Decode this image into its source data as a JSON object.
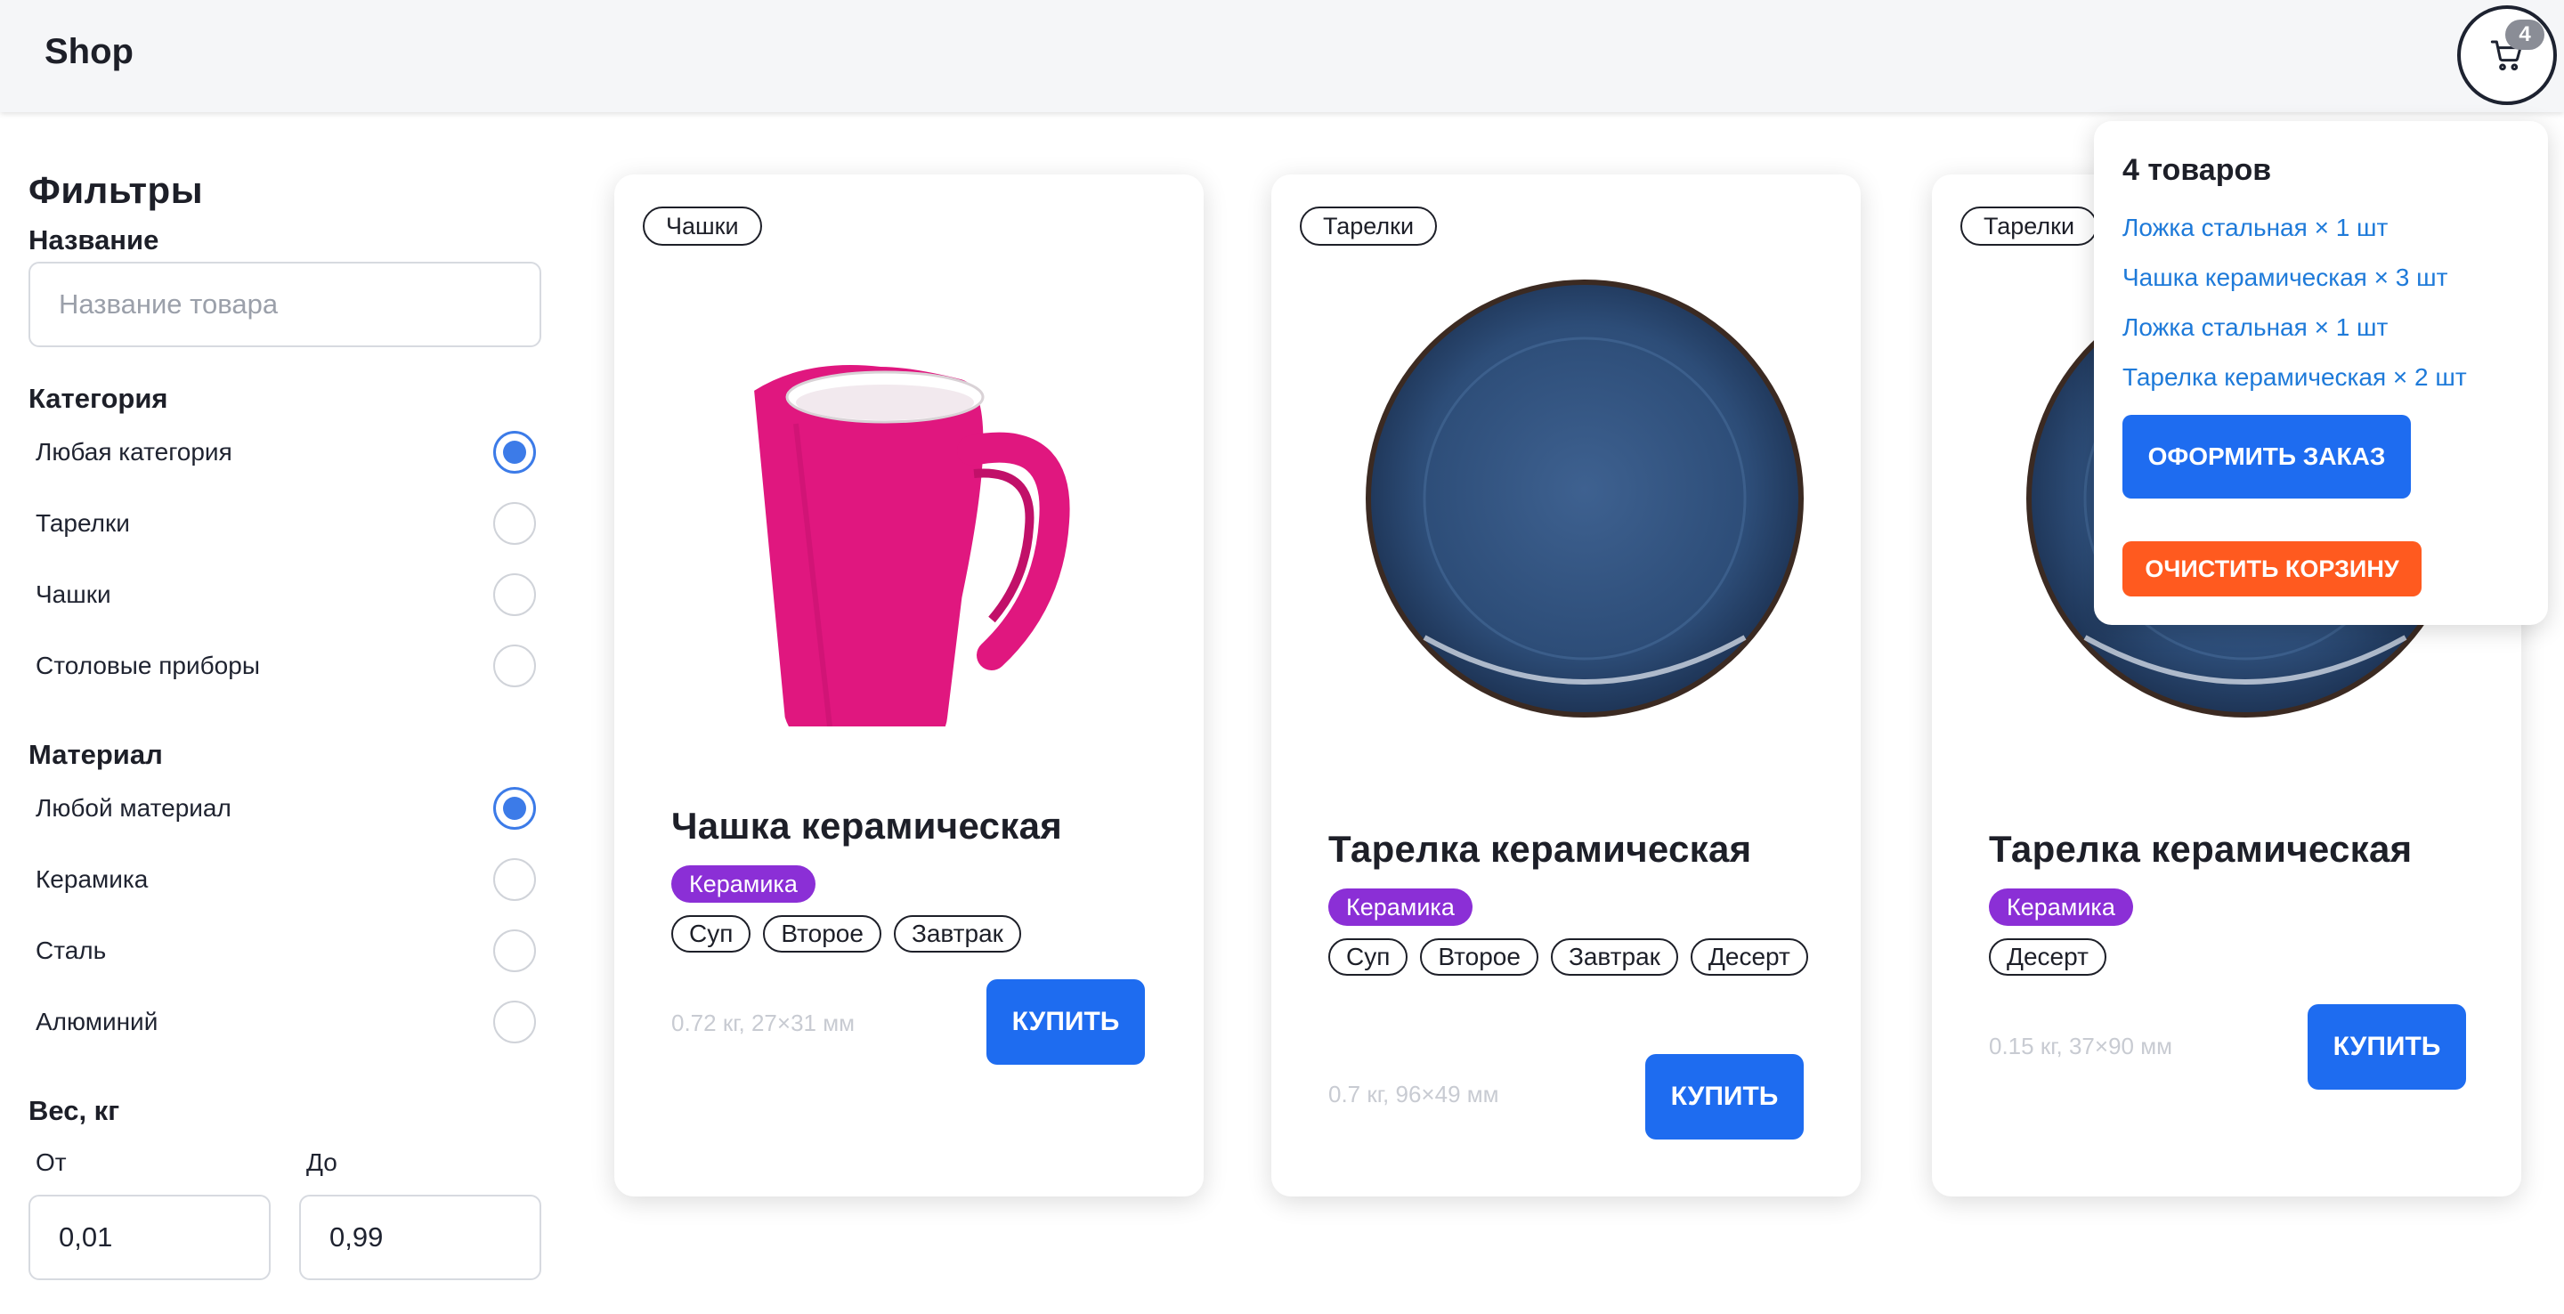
{
  "header": {
    "logo": "Shop",
    "cart_count": "4"
  },
  "filters": {
    "title": "Фильтры",
    "name_label": "Название",
    "name_placeholder": "Название товара",
    "category_label": "Категория",
    "categories": [
      {
        "label": "Любая категория",
        "checked": true
      },
      {
        "label": "Тарелки",
        "checked": false
      },
      {
        "label": "Чашки",
        "checked": false
      },
      {
        "label": "Столовые приборы",
        "checked": false
      }
    ],
    "material_label": "Материал",
    "materials": [
      {
        "label": "Любой материал",
        "checked": true
      },
      {
        "label": "Керамика",
        "checked": false
      },
      {
        "label": "Сталь",
        "checked": false
      },
      {
        "label": "Алюминий",
        "checked": false
      }
    ],
    "weight_label": "Вес, кг",
    "from_label": "От",
    "to_label": "До",
    "from_value": "0,01",
    "to_value": "0,99"
  },
  "products": [
    {
      "category": "Чашки",
      "title": "Чашка керамическая",
      "material": "Керамика",
      "tags": [
        "Суп",
        "Второе",
        "Завтрак"
      ],
      "meta": "0.72 кг, 27×31 мм",
      "buy": "КУПИТЬ",
      "image": "pink-mug",
      "image_color": "#e0177f"
    },
    {
      "category": "Тарелки",
      "title": "Тарелка керамическая",
      "material": "Керамика",
      "tags": [
        "Суп",
        "Второе",
        "Завтрак",
        "Десерт"
      ],
      "meta": "0.7 кг, 96×49 мм",
      "buy": "КУПИТЬ",
      "image": "blue-plate",
      "image_color": "#2d4d78"
    },
    {
      "category": "Тарелки",
      "title": "Тарелка керамическая",
      "material": "Керамика",
      "tags": [
        "Десерт"
      ],
      "meta": "0.15 кг, 37×90 мм",
      "buy": "КУПИТЬ",
      "image": "blue-plate",
      "image_color": "#2d4d78"
    }
  ],
  "cart": {
    "count_label": "4 товаров",
    "items": [
      "Ложка стальная × 1 шт",
      "Чашка керамическая × 3 шт",
      "Ложка стальная × 1 шт",
      "Тарелка керамическая × 2 шт"
    ],
    "order_button": "ОФОРМИТЬ ЗАКАЗ",
    "clear_button": "ОЧИСТИТЬ КОРЗИНУ"
  },
  "colors": {
    "accent": "#1e6cf0",
    "material_tag": "#8b2fd6",
    "danger": "#ff5a1f",
    "link": "#1e7ad9"
  }
}
